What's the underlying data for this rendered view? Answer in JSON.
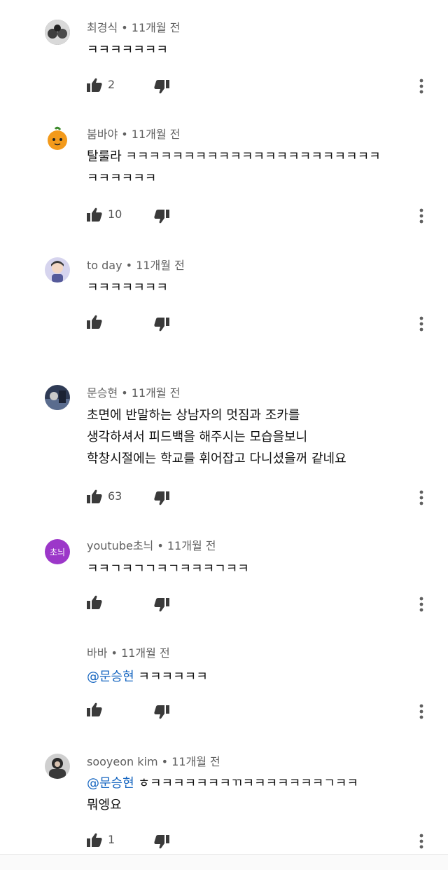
{
  "comments": [
    {
      "author": "최경식",
      "meta_sep": " • ",
      "time": "11개월 전",
      "mention": "",
      "text": "ㅋㅋㅋㅋㅋㅋㅋ",
      "likes": "2",
      "avatar_icon": "user-photo-icon",
      "avatar_color": "#5b5b5b"
    },
    {
      "author": "붐바야",
      "meta_sep": " • ",
      "time": "11개월 전",
      "mention": "",
      "text": "탈룰라 ㅋㅋㅋㅋㅋㅋㅋㅋㅋㅋㅋㅋㅋㅋㅋㅋㅋㅋㅋㅋㅋㅋ\nㅋㅋㅋㅋㅋㅋ",
      "likes": "10",
      "avatar_icon": "orange-character-icon",
      "avatar_color": "#f39a1b"
    },
    {
      "author": "to day",
      "meta_sep": " • ",
      "time": "11개월 전",
      "mention": "",
      "text": "ㅋㅋㅋㅋㅋㅋㅋ",
      "likes": "",
      "avatar_icon": "character-avatar-icon",
      "avatar_color": "#c8c6e8"
    },
    {
      "author": "문승현",
      "meta_sep": " • ",
      "time": "11개월 전",
      "mention": "",
      "text": "초면에 반말하는 상남자의 멋짐과 조카를\n생각하셔서 피드백을 해주시는 모습을보니\n학창시절에는 학교를 휘어잡고 다니셨을꺼 같네요",
      "likes": "63",
      "avatar_icon": "photo-avatar-icon",
      "avatar_color": "#3a4a66"
    },
    {
      "author": "youtube초늬",
      "meta_sep": " • ",
      "time": "11개월 전",
      "mention": "",
      "text": "ㅋㅋㄱㅋㄱㄱㅋㄱㅋㅋㅋㄱㅋㅋ",
      "likes": "",
      "avatar_icon": "initial-avatar-icon",
      "avatar_label": "초늬",
      "avatar_color": "#9c37c9"
    },
    {
      "author": "바바",
      "meta_sep": " • ",
      "time": "11개월 전",
      "mention": "@문승현",
      "text": " ㅋㅋㅋㅋㅋㅋ",
      "likes": "",
      "avatar_icon": "",
      "avatar_color": ""
    },
    {
      "author": "sooyeon kim",
      "meta_sep": " • ",
      "time": "11개월 전",
      "mention": "@문승현",
      "text": "  ㅎㅋㅋㅋㅋㅋㅋㅋㄲㅋㅋㅋㅋㅋㅋㅋㄱㅋㅋ\n뭐엥요",
      "likes": "1",
      "avatar_icon": "photo-avatar-icon",
      "avatar_color": "#2a2a2a"
    }
  ],
  "icons": {
    "like": "thumbs-up-icon",
    "dislike": "thumbs-down-icon",
    "more": "more-vert-icon"
  }
}
